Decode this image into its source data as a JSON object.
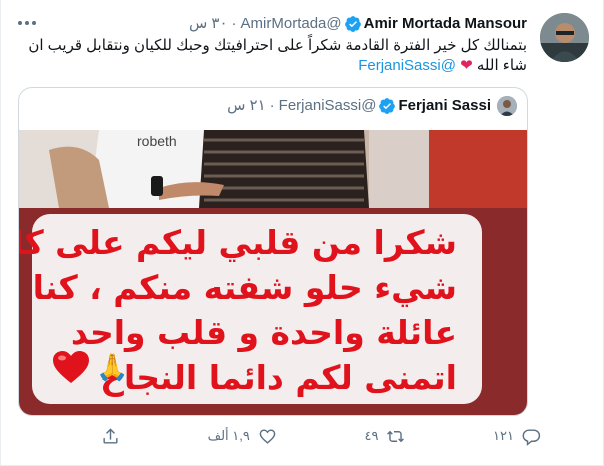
{
  "tweet": {
    "display_name": "Amir Mortada Mansour",
    "handle": "@AmirMortada",
    "time": "٣٠ س",
    "text_line1": "بتمنالك كل خير الفترة القادمة شكراً على احترافيتك وحبك للكيان ونتقابل قريب ان",
    "text_line2_prefix": "شاء الله",
    "mention": "@FerjaniSassi"
  },
  "quote": {
    "display_name": "Ferjani Sassi",
    "handle": "@FerjaniSassi",
    "time": "٢١ س",
    "image_lines": [
      "شكرا من قلبي ليكم على كل",
      "شيء حلو شفته منكم ، كنا",
      "عائلة واحدة  و قلب واحد",
      "اتمنى لكم دائما النجاح"
    ],
    "shirt_text": "robeth"
  },
  "actions": {
    "replies": "١٢١",
    "retweets": "٤٩",
    "likes": "١,٩ ألف"
  },
  "colors": {
    "accent": "#1b95e0",
    "muted": "#5b7083",
    "card_text": "#e0121c"
  }
}
